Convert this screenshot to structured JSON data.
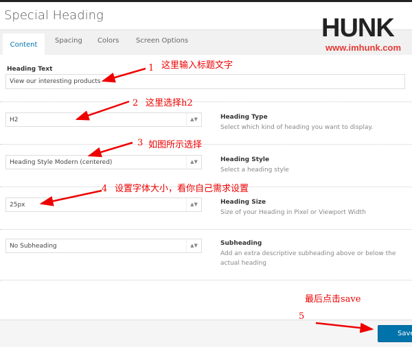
{
  "dialog": {
    "title": "Special Heading"
  },
  "tabs": [
    "Content",
    "Spacing",
    "Colors",
    "Screen Options"
  ],
  "logo": {
    "text": "HUNK",
    "url": "www.imhunk.com"
  },
  "fields": {
    "heading_text": {
      "label": "Heading Text",
      "value": "View our interesting products"
    },
    "heading_type": {
      "value": "H2",
      "title": "Heading Type",
      "desc": "Select which kind of heading you want to display."
    },
    "heading_style": {
      "value": "Heading Style Modern (centered)",
      "title": "Heading Style",
      "desc": "Select a heading style"
    },
    "heading_size": {
      "value": "25px",
      "title": "Heading Size",
      "desc": "Size of your Heading in Pixel or Viewport Width"
    },
    "subheading": {
      "value": "No Subheading",
      "title": "Subheading",
      "desc": "Add an extra descriptive subheading above or below the actual heading"
    }
  },
  "footer": {
    "save_label": "Save"
  },
  "annotations": [
    {
      "num": "1",
      "text": "这里输入标题文字"
    },
    {
      "num": "2",
      "text": "这里选择h2"
    },
    {
      "num": "3",
      "text": "如图所示选择"
    },
    {
      "num": "4",
      "text": "设置字体大小，看你自己需求设置"
    },
    {
      "num": "5",
      "text": "最后点击save"
    }
  ],
  "colors": {
    "accent": "#0073aa",
    "annotation": "#ee0000"
  }
}
